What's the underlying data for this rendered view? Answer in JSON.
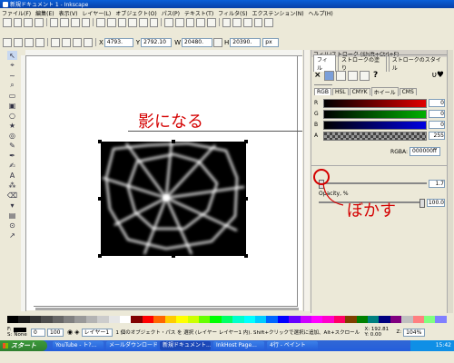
{
  "window": {
    "title": "新規ドキュメント 1 - Inkscape"
  },
  "menu": [
    "ファイル(F)",
    "編集(E)",
    "表示(V)",
    "レイヤー(L)",
    "オブジェクト(O)",
    "パス(P)",
    "テキスト(T)",
    "フィルタ(S)",
    "エクステンション(N)",
    "ヘルプ(H)"
  ],
  "toolbar": {
    "x_value": "4793.",
    "y_value": "2792.10",
    "w_value": "20480.",
    "h_value": "20390.",
    "unit": "px"
  },
  "annotations": {
    "shadow_label": "影になる",
    "blur_label": "ぼかす"
  },
  "panel": {
    "header": "フィル/ストローク (Shift+Ctrl+F)",
    "tabs": [
      "フィル",
      "ストロークの塗り",
      "ストロークのスタイル"
    ],
    "mode_tabs": [
      "RGB",
      "HSL",
      "CMYK",
      "ホイール",
      "CMS"
    ],
    "unknown_mark": "?",
    "channels": [
      {
        "label": "R",
        "value": "0",
        "color": "#e00000"
      },
      {
        "label": "G",
        "value": "0",
        "color": "#00b000"
      },
      {
        "label": "B",
        "value": "0",
        "color": "#0000e0"
      },
      {
        "label": "A",
        "value": "255",
        "color": "#444444"
      }
    ],
    "rgba_label": "RGBA:",
    "rgba_value": "000000ff",
    "blur_value": "1.7",
    "opacity_label": "Opacity, %",
    "opacity_value": "100.0"
  },
  "status": {
    "fill_label": "F:",
    "stroke_label": "S:",
    "stroke_value": "None",
    "opacity": "0",
    "zoom": "100",
    "layer": "レイヤー1",
    "message": "1 個のオブジェクト・パス を 選択 (レイヤー レイヤー1 内). Shift+クリックで選択に追加、Alt+スクロールでズーム...",
    "coords_x": "X: 192.81",
    "coords_y": "Y: 0.00",
    "zoom_label": "Z:",
    "zoom_value": "104%"
  },
  "taskbar": {
    "start": "スタート",
    "items": [
      "YouTube - ト?...",
      "メールダウンロード - 2007",
      "新規ドキュメント...",
      "InkHost Page...",
      "4行 - ペイント"
    ],
    "clock": "15:42"
  },
  "palette_colors": [
    "#000000",
    "#1a1a1a",
    "#333333",
    "#4d4d4d",
    "#666666",
    "#808080",
    "#999999",
    "#b3b3b3",
    "#cccccc",
    "#e6e6e6",
    "#ffffff",
    "#800000",
    "#ff0000",
    "#ff6600",
    "#ffcc00",
    "#ffff00",
    "#ccff00",
    "#66ff00",
    "#00ff00",
    "#00ff66",
    "#00ffcc",
    "#00ffff",
    "#00ccff",
    "#0066ff",
    "#0000ff",
    "#6600ff",
    "#cc00ff",
    "#ff00ff",
    "#ff00cc",
    "#ff0066",
    "#804000",
    "#008000",
    "#008080",
    "#000080",
    "#800080",
    "#c0c0c0",
    "#ff8080",
    "#80ff80",
    "#8080ff"
  ],
  "colors": {
    "accent_red": "#d40000",
    "panel_bg": "#ece9d8",
    "canvas_bg": "#ffffff",
    "taskbar": "#245edb"
  }
}
